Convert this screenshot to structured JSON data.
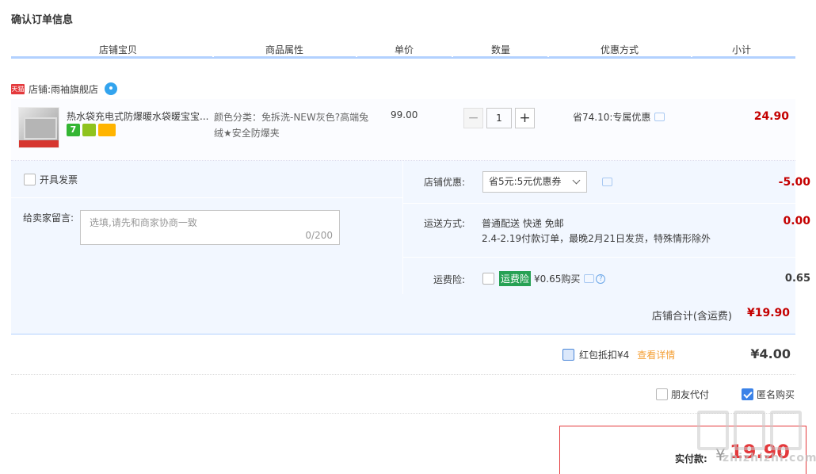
{
  "page_title": "确认订单信息",
  "columns": [
    "店铺宝贝",
    "商品属性",
    "单价",
    "数量",
    "优惠方式",
    "小计"
  ],
  "shop": {
    "badge": "天猫",
    "label": "店铺:",
    "name": "雨袖旗舰店"
  },
  "item": {
    "name": "热水袋充电式防爆暖水袋暖宝宝...",
    "badges": [
      "7",
      "gift-icon",
      "card-icon"
    ],
    "attr": "颜色分类：免拆洗-NEW灰色?高端兔绒★安全防爆夹",
    "price": "99.00",
    "qty": "1",
    "promo": "省74.10:专属优惠",
    "subtotal": "24.90"
  },
  "options": {
    "invoice_label": "开具发票",
    "memo_label": "给卖家留言:",
    "memo_placeholder": "选填,请先和商家协商一致",
    "memo_count": "0/200",
    "shop_promo_label": "店铺优惠:",
    "shop_promo_value": "省5元:5元优惠券",
    "shop_promo_amount": "-5.00",
    "ship_label": "运送方式:",
    "ship_line1": "普通配送 快递 免邮",
    "ship_line2": "2.4-2.19付款订单，最晚2月21日发货，特殊情形除外",
    "ship_amount": "0.00",
    "insure_label": "运费险:",
    "insure_tag": "运费险",
    "insure_price": "¥0.65购买",
    "insure_amount": "0.65"
  },
  "subtotal": {
    "label": "店铺合计(含运费)",
    "value": "¥19.90"
  },
  "hongbao": {
    "label": "红包抵扣¥4",
    "link": "查看详情",
    "amount": "¥4.00"
  },
  "extras": {
    "friend_pay": "朋友代付",
    "anon_buy": "匿名购买"
  },
  "pay": {
    "label": "实付款:",
    "yuan": "¥",
    "amount": "19.90"
  },
  "watermark": {
    "text": "zhizhizhi.com"
  },
  "colors": {
    "accent_red": "#c40000",
    "header_line": "#b2d1ff",
    "option_bg": "#f2f7ff",
    "insure_green": "#27a154"
  }
}
